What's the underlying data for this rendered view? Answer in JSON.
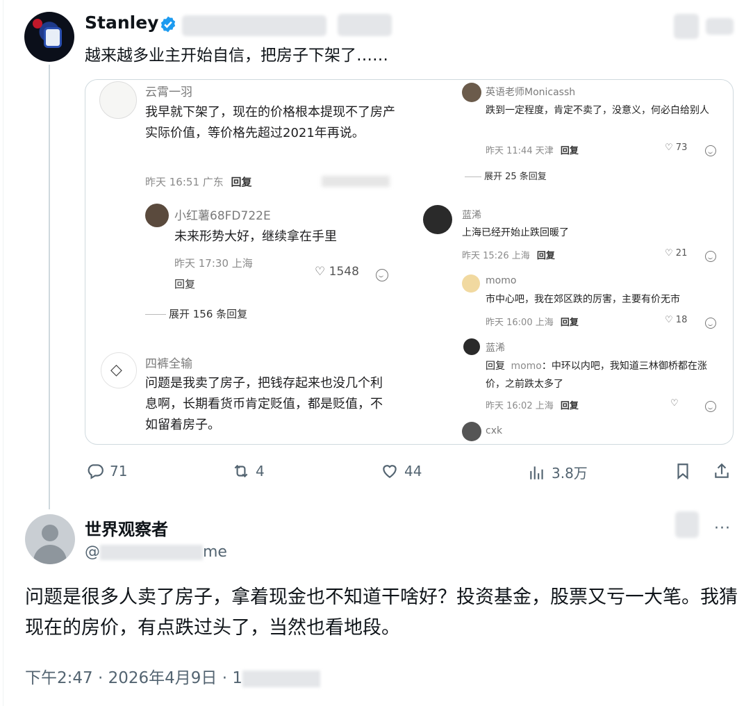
{
  "tweet": {
    "author_name": "Stanley",
    "text": "越来越多业主开始自信，把房子下架了……",
    "stats": {
      "replies": "71",
      "retweets": "4",
      "likes": "44",
      "views": "3.8万"
    }
  },
  "embed": {
    "left_comments": [
      {
        "name": "云霄一羽",
        "text": "我早就下架了，现在的价格根本提现不了房产实际价值，等价格先超过2021年再说。",
        "time": "昨天 16:51 广东",
        "reply_label": "回复"
      },
      {
        "name": "小红薯68FD722E",
        "text": "未来形势大好，继续拿在手里",
        "time": "昨天 17:30 上海",
        "reply_label": "回复",
        "likes": "1548"
      },
      {
        "name": "四裤全输",
        "text": "问题是我卖了房子，把钱存起来也没几个利息啊，长期看货币肯定贬值，都是贬值，不如留着房子。"
      }
    ],
    "left_expand": "展开 156 条回复",
    "right_comments": [
      {
        "name": "英语老师Monicassh",
        "text": "跌到一定程度，肯定不卖了，没意义，何必白给别人",
        "time": "昨天 11:44 天津",
        "reply_label": "回复",
        "likes": "73"
      },
      {
        "name": "蓝浠",
        "text": "上海已经开始止跌回暖了",
        "time": "昨天 15:26 上海",
        "reply_label": "回复",
        "likes": "21"
      },
      {
        "name": "momo",
        "text": "市中心吧，我在郊区跌的厉害，主要有价无市",
        "time": "昨天 16:00 上海",
        "reply_label": "回复",
        "likes": "18"
      },
      {
        "name": "蓝浠",
        "text_prefix": "回复",
        "text_mention": "momo",
        "text": "：中环以内吧，我知道三林御桥都在涨价，之前跌太多了",
        "time": "昨天 16:02 上海",
        "reply_label": "回复"
      },
      {
        "name": "cxk"
      }
    ],
    "right_expand": "展开 25 条回复"
  },
  "reply": {
    "author_name": "世界观察者",
    "handle_prefix": "@",
    "handle_suffix": "me",
    "more": "···",
    "text": "问题是很多人卖了房子，拿着现金也不知道干啥好？投资基金，股票又亏一大笔。我猜现在的房价，有点跌过头了，当然也看地段。",
    "timestamp": "下午2:47 · 2026年4月9日 · 1"
  },
  "colors": {
    "verified": "#1d9bf0",
    "secondary_text": "#536471",
    "border": "#cfd9de"
  },
  "icons": [
    "verified-icon",
    "reply-icon",
    "retweet-icon",
    "like-icon",
    "views-icon",
    "bookmark-icon",
    "share-icon",
    "more-icon"
  ]
}
